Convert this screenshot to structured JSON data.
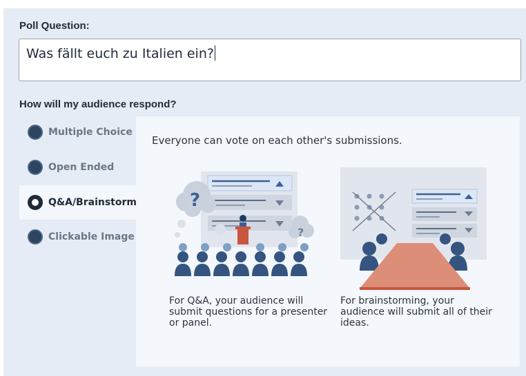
{
  "poll": {
    "question_label": "Poll Question:",
    "question_value": "Was fällt euch zu Italien ein?"
  },
  "respond": {
    "label": "How will my audience respond?",
    "options": [
      {
        "label": "Multiple Choice",
        "selected": false
      },
      {
        "label": "Open Ended",
        "selected": false
      },
      {
        "label": "Q&A/Brainstorm",
        "selected": true
      },
      {
        "label": "Clickable Image",
        "selected": false
      }
    ]
  },
  "detail": {
    "description": "Everyone can vote on each other's submissions.",
    "qa_caption": "For Q&A, your audience will submit questions for a presenter or panel.",
    "brainstorm_caption": "For brainstorming, your audience will submit all of their ideas."
  },
  "colors": {
    "panel_bg": "#e6ecf5",
    "accent_blue": "#3f5f94",
    "podium_red": "#c8553d",
    "table_salmon": "#dd8e78"
  }
}
